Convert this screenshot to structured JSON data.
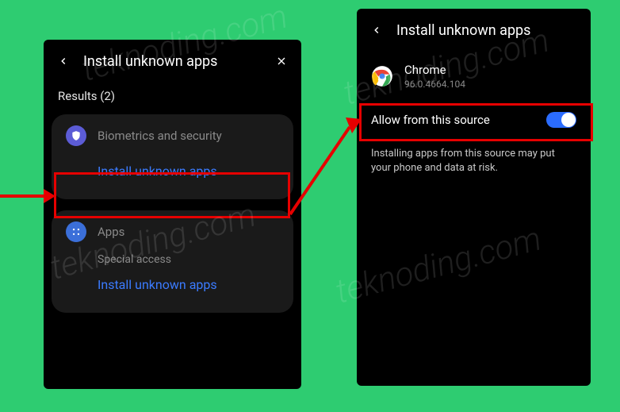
{
  "left": {
    "header_title": "Install unknown apps",
    "results": "Results (2)",
    "card1_header": "Biometrics and security",
    "card1_link": "Install unknown apps",
    "card2_header": "Apps",
    "card2_sub": "Special access",
    "card2_link": "Install unknown apps"
  },
  "right": {
    "header_title": "Install unknown apps",
    "app_name": "Chrome",
    "app_version": "96.0.4664.104",
    "toggle_label": "Allow from this source",
    "warning": "Installing apps from this source may put your phone and data at risk."
  },
  "watermark": "teknoding.com"
}
